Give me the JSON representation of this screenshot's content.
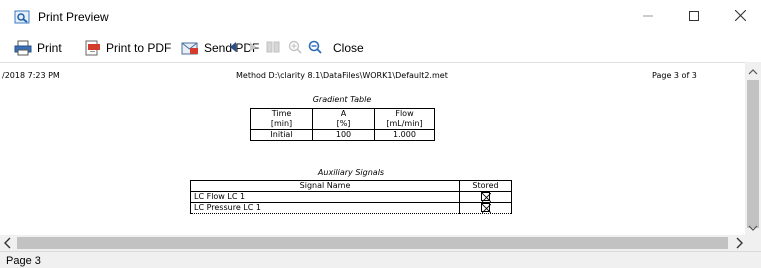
{
  "window": {
    "title": "Print Preview",
    "minimize_icon": "minimize-icon",
    "maximize_icon": "maximize-icon",
    "close_icon": "close-icon"
  },
  "toolbar": {
    "print_label": "Print",
    "print_to_pdf_label": "Print to PDF",
    "send_pdf_label": "Send PDF",
    "close_label": "Close",
    "icons": [
      "printer-icon",
      "pdf-icon",
      "send-pdf-icon",
      "previous-page-icon",
      "next-page-icon",
      "multi-page-icon",
      "zoom-in-icon",
      "zoom-out-icon"
    ]
  },
  "page": {
    "header_left": "/2018   7:23 PM",
    "header_center": "Method D:\\clarity 8.1\\DataFiles\\WORK1\\Default2.met",
    "header_right": "Page 3 of 3",
    "gradient_table": {
      "caption": "Gradient Table",
      "columns": [
        {
          "line1": "Time",
          "line2": "[min]"
        },
        {
          "line1": "A",
          "line2": "[%]"
        },
        {
          "line1": "Flow",
          "line2": "[mL/min]"
        }
      ],
      "rows": [
        [
          "Initial",
          "100",
          "1.000"
        ]
      ]
    },
    "aux_table": {
      "caption": "Auxiliary Signals",
      "columns": [
        "Signal Name",
        "Stored"
      ],
      "rows": [
        {
          "name": "LC Flow LC 1",
          "stored": true
        },
        {
          "name": "LC Pressure LC 1",
          "stored": true
        }
      ]
    }
  },
  "status": {
    "page_label": "Page 3"
  },
  "colors": {
    "chrome": "#f0f0f0",
    "scroll_thumb": "#c2c2c2",
    "zoom_out_accent": "#2d6db5"
  }
}
